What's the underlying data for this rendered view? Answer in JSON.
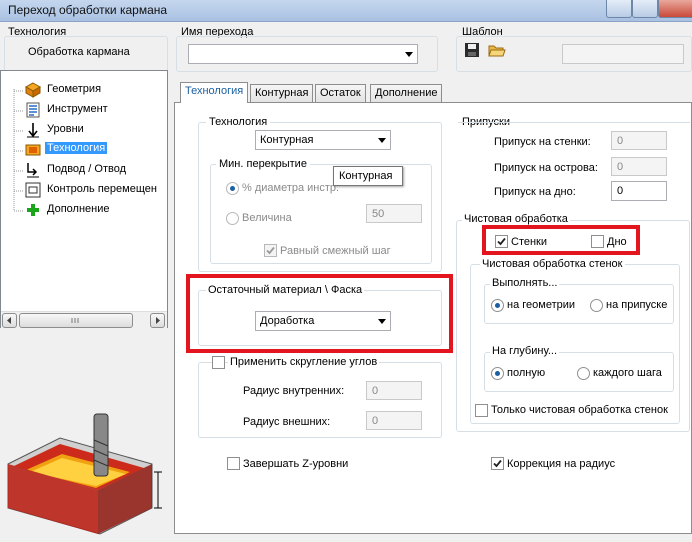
{
  "window": {
    "title": "Переход обработки кармана"
  },
  "header": {
    "technology_label": "Технология",
    "technology_value": "Обработка кармана",
    "transition_name_label": "Имя перехода",
    "transition_name_value": "",
    "template_label": "Шаблон"
  },
  "tree": {
    "items": [
      {
        "label": "Геометрия",
        "icon": "geometry-icon"
      },
      {
        "label": "Инструмент",
        "icon": "tool-icon"
      },
      {
        "label": "Уровни",
        "icon": "levels-icon"
      },
      {
        "label": "Технология",
        "icon": "technology-icon"
      },
      {
        "label": "Подвод / Отвод",
        "icon": "approach-icon"
      },
      {
        "label": "Контроль перемещен",
        "icon": "motion-control-icon"
      },
      {
        "label": "Дополнение",
        "icon": "plus-icon"
      }
    ],
    "selected_index": 3
  },
  "tabs": [
    "Технология",
    "Контурная",
    "Остаток",
    "Дополнение"
  ],
  "technology_group": {
    "label": "Технология",
    "mode_value": "Контурная",
    "tooltip": "Контурная",
    "min_overlap": {
      "label": "Мин. перекрытие",
      "percent_label": "% диаметра инстр.",
      "value_label": "Величина",
      "value": "50",
      "equal_step_label": "Равный смежный шаг"
    }
  },
  "residual_group": {
    "label": "Остаточный материал \\ Фаска",
    "value": "Доработка"
  },
  "rounding_group": {
    "label": "Применить скругление углов",
    "inner_label": "Радиус внутренних:",
    "inner_value": "0",
    "outer_label": "Радиус внешних:",
    "outer_value": "0"
  },
  "allowances": {
    "label": "Припуски",
    "walls_label": "Припуск на стенки:",
    "walls_value": "0",
    "islands_label": "Припуск на острова:",
    "islands_value": "0",
    "floor_label": "Припуск на дно:",
    "floor_value": "0"
  },
  "finishing": {
    "label": "Чистовая обработка",
    "walls_label": "Стенки",
    "floor_label": "Дно",
    "walls_group_label": "Чистовая обработка стенок",
    "execute_label": "Выполнять...",
    "on_geometry": "на геометрии",
    "on_allowance": "на припуске",
    "depth_label": "На глубину...",
    "full": "полную",
    "each_step": "каждого шага",
    "only_finish": "Только чистовая обработка стенок"
  },
  "bottom": {
    "finish_z": "Завершать Z-уровни",
    "radius_correction": "Коррекция на радиус"
  },
  "colors": {
    "highlight": "#e3151f",
    "accent": "#1c5fa3",
    "selection": "#3399ff"
  }
}
